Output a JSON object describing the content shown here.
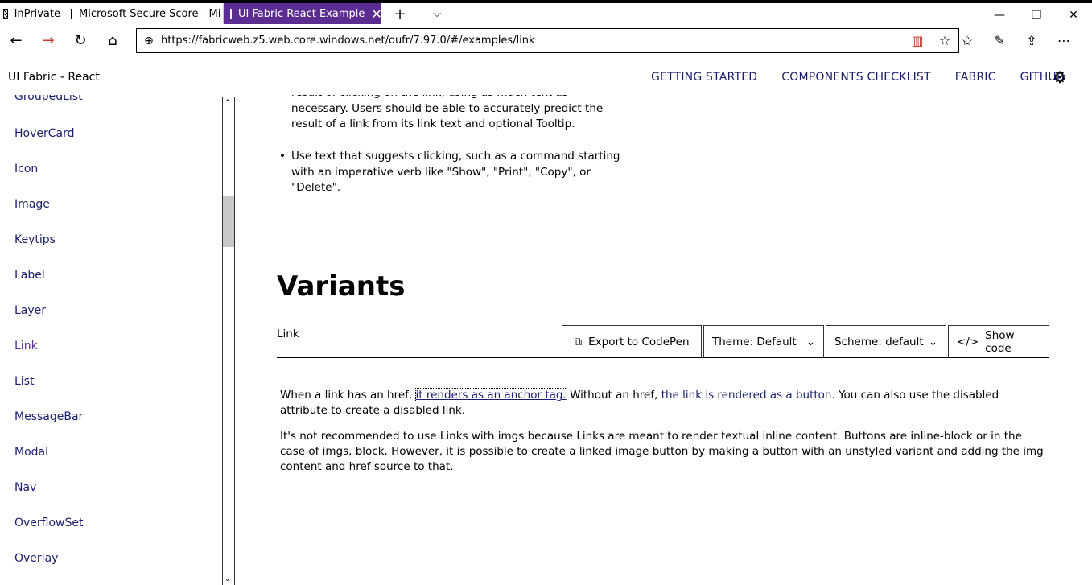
{
  "browser": {
    "inprivate_label": "InPrivate",
    "tabs": [
      {
        "title": "Microsoft Secure Score - Mi"
      },
      {
        "title": "UI Fabric React Example"
      }
    ],
    "url": "https://fabricweb.z5.web.core.windows.net/oufr/7.97.0/#/examples/link"
  },
  "header": {
    "brand": "UI Fabric - React",
    "nav": [
      "GETTING STARTED",
      "COMPONENTS CHECKLIST",
      "FABRIC",
      "GITHUB"
    ]
  },
  "sidebar": {
    "items": [
      "GroupedList",
      "HoverCard",
      "Icon",
      "Image",
      "Keytips",
      "Label",
      "Layer",
      "Link",
      "List",
      "MessageBar",
      "Modal",
      "Nav",
      "OverflowSet",
      "Overlay"
    ],
    "active": "Link"
  },
  "main": {
    "bullet1_tail": "result of clicking on the link, using as much text as necessary. Users should be able to accurately predict the result of a link from its link text and optional Tooltip.",
    "bullet2": "Use text that suggests clicking, such as a command starting with an imperative verb like \"Show\", \"Print\", \"Copy\", or \"Delete\".",
    "heading": "Variants",
    "example_label": "Link",
    "toolbar": {
      "codepen": "Export to CodePen",
      "theme": "Theme: Default",
      "scheme": "Scheme: default",
      "show_code": "Show code"
    },
    "para1": {
      "a": "When a link has an href, ",
      "link1": "it renders as an anchor tag.",
      "b": " Without an href, ",
      "link2": "the link is rendered as a button",
      "c": ". You can also use the disabled attribute to create a disabled link."
    },
    "para2": "It's not recommended to use Links with imgs because Links are meant to render textual inline content. Buttons are inline-block or in the case of imgs, block. However, it is possible to create a linked image button by making a button with an unstyled variant and adding the img content and href source to that."
  }
}
